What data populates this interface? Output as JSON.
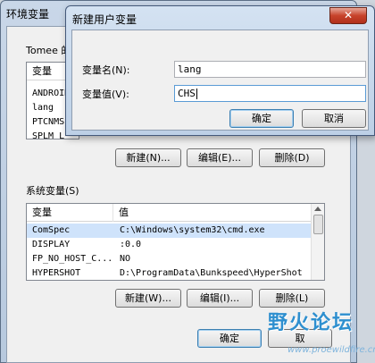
{
  "env_window": {
    "title": "环境变量",
    "user_group_label": "Tomee 的",
    "user_vars": {
      "columns": [
        "变量"
      ],
      "rows": [
        {
          "name": "ANDROID"
        },
        {
          "name": "lang"
        },
        {
          "name": "PTCNMS"
        },
        {
          "name": "SPLM L"
        }
      ]
    },
    "user_buttons": {
      "new": "新建(N)...",
      "edit": "编辑(E)...",
      "delete": "删除(D)"
    },
    "system_group_label": "系统变量(S)",
    "sys_vars": {
      "columns": [
        "变量",
        "值"
      ],
      "rows": [
        {
          "name": "ComSpec",
          "value": "C:\\Windows\\system32\\cmd.exe"
        },
        {
          "name": "DISPLAY",
          "value": ":0.0"
        },
        {
          "name": "FP_NO_HOST_C...",
          "value": "NO"
        },
        {
          "name": "HYPERSHOT",
          "value": "D:\\ProgramData\\Bunkspeed\\HyperShot"
        }
      ]
    },
    "sys_buttons": {
      "new": "新建(W)...",
      "edit": "编辑(I)...",
      "delete": "删除(L)"
    },
    "ok": "确定",
    "cancel": "取"
  },
  "new_var_dialog": {
    "title": "新建用户变量",
    "close": "✕",
    "name_label": "变量名(N):",
    "name_value": "lang",
    "value_label": "变量值(V):",
    "value_value": "CHS",
    "ok": "确定",
    "cancel": "取消"
  },
  "watermark": {
    "text": "野火论坛",
    "url": "www.proewildfire.cn"
  }
}
